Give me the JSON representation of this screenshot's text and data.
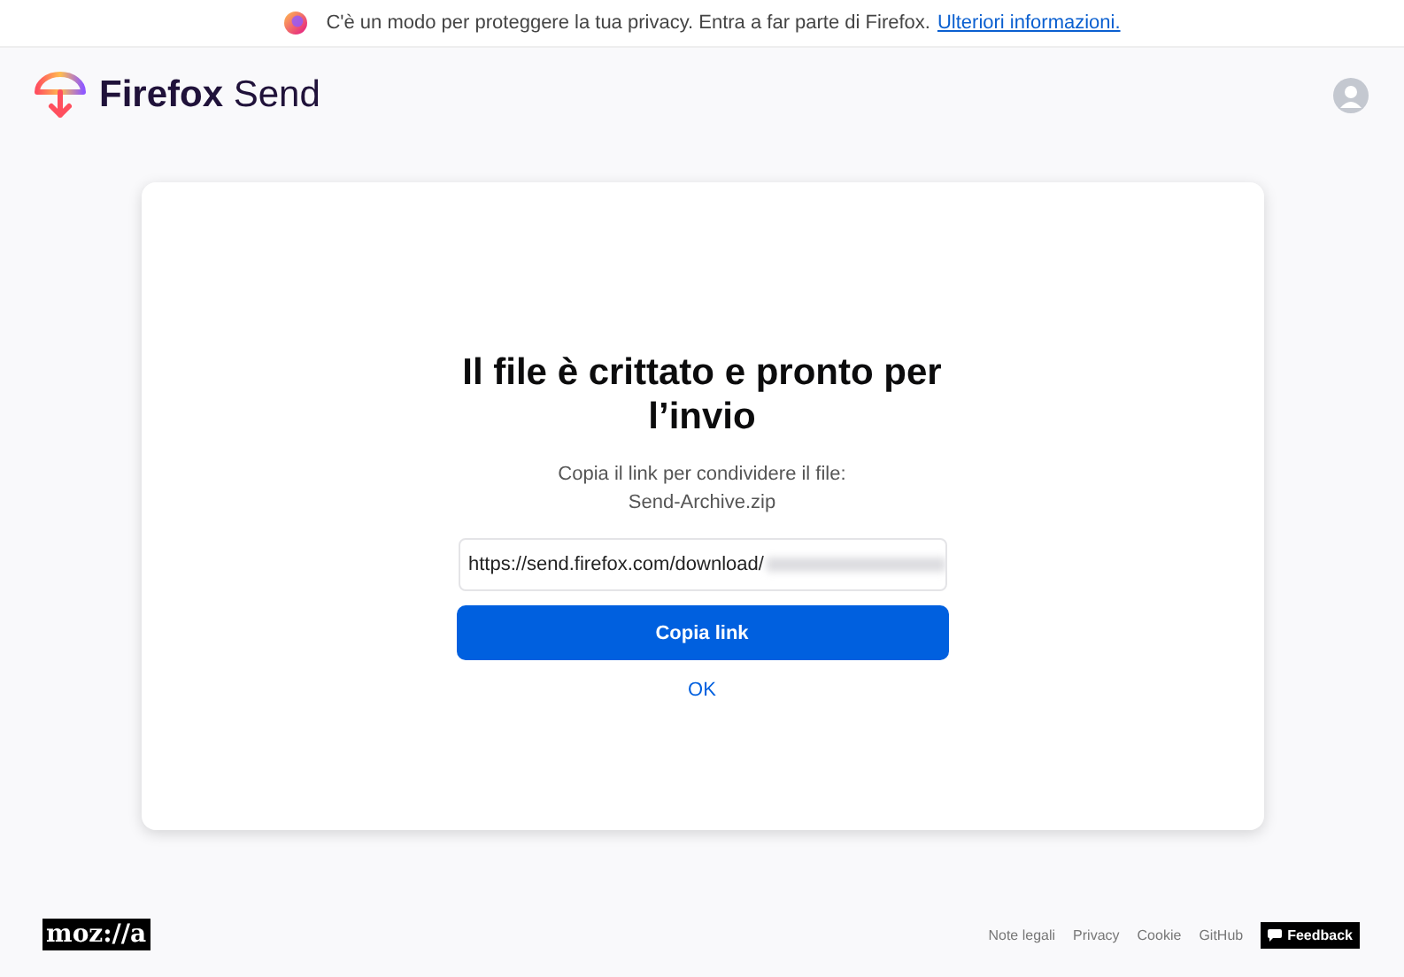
{
  "banner": {
    "text": "C'è un modo per proteggere la tua privacy. Entra a far parte di Firefox.",
    "link": "Ulteriori informazioni."
  },
  "header": {
    "brand_bold": "Firefox",
    "brand": "Send"
  },
  "card": {
    "title": "Il file è crittato e pronto per l’invio",
    "subtitle": "Copia il link per condividere il file:",
    "filename": "Send-Archive.zip",
    "url": "https://send.firefox.com/download/",
    "copy_button": "Copia link",
    "ok_link": "OK"
  },
  "footer": {
    "logo": "moz://a",
    "links": [
      "Note legali",
      "Privacy",
      "Cookie",
      "GitHub"
    ],
    "feedback": "Feedback"
  }
}
